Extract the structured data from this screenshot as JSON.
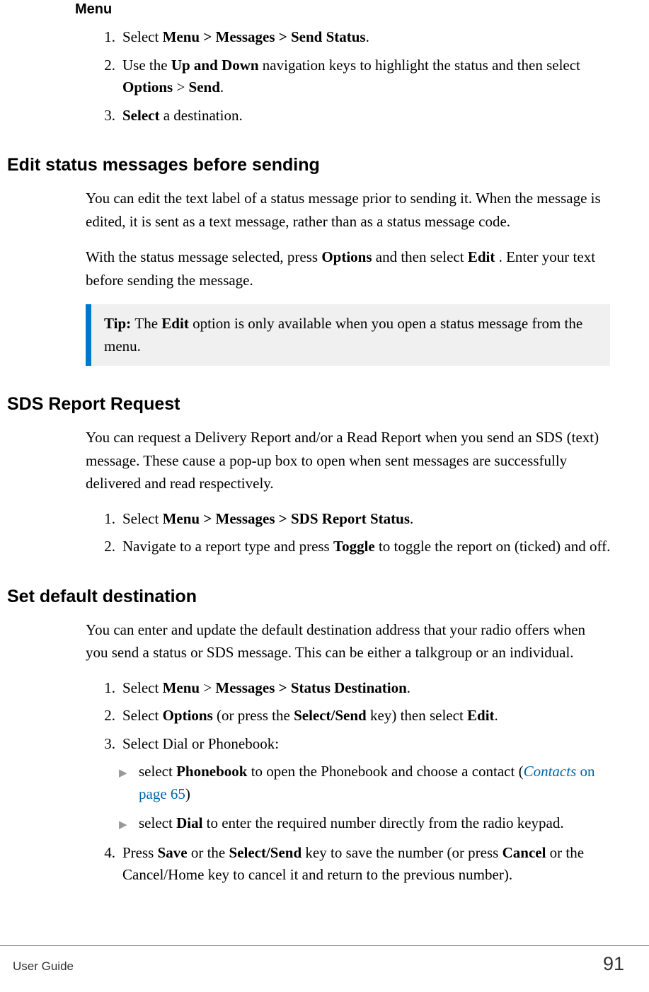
{
  "headings": {
    "menu": "Menu",
    "edit_status": "Edit status messages before sending",
    "sds_report": "SDS Report Request",
    "set_default": "Set default destination"
  },
  "menu_steps": {
    "s1_pre": "Select ",
    "s1_bold": "Menu > Messages > Send Status",
    "s1_post": ".",
    "s2_pre": "Use the ",
    "s2_b1": "Up and Down",
    "s2_mid": " navigation keys to highlight the status and then select ",
    "s2_b2": "Options",
    "s2_mid2": " > ",
    "s2_b3": "Send",
    "s2_post": ".",
    "s3_b": "Select",
    "s3_post": " a destination."
  },
  "edit_status": {
    "p1": "You can edit the text label of a status message prior to sending it. When the message is edited, it is sent as a text message, rather than as a status message code.",
    "p2_pre": "With the status message selected, press ",
    "p2_b1": "Options",
    "p2_mid": " and then select ",
    "p2_b2": "Edit",
    "p2_post": " . Enter your text before sending the message."
  },
  "tip": {
    "label": "Tip: ",
    "pre": " The ",
    "b": "Edit",
    "post": " option is only available when you open a status message from the menu."
  },
  "sds": {
    "p1": "You can request a Delivery Report and/or a Read Report when you send an SDS (text) message. These cause a pop-up box to open when sent messages are successfully delivered and read respectively.",
    "s1_pre": "Select ",
    "s1_bold": "Menu > Messages > SDS Report Status",
    "s1_post": ".",
    "s2_pre": "Navigate to a report type and press ",
    "s2_b": "Toggle",
    "s2_post": " to toggle the report on (ticked) and off."
  },
  "dest": {
    "p1": "You can enter and update the default destination address that your radio offers when you send a status or SDS message. This can be either a talkgroup or an individual.",
    "s1_pre": "Select ",
    "s1_b1": "Menu",
    "s1_mid": " > ",
    "s1_b2": "Messages > Status Destination",
    "s1_post": ".",
    "s2_pre": "Select ",
    "s2_b1": "Options",
    "s2_mid": " (or press the ",
    "s2_b2": "Select/Send",
    "s2_mid2": " key) then select ",
    "s2_b3": "Edit",
    "s2_post": ".",
    "s3": "Select Dial or Phonebook:",
    "sub1_pre": "select ",
    "sub1_b": "Phonebook",
    "sub1_mid": " to open the Phonebook and choose a contact (",
    "sub1_link_title": "Contacts",
    "sub1_link_rest": " on page 65",
    "sub1_post": ")",
    "sub2_pre": "select ",
    "sub2_b": "Dial",
    "sub2_post": " to enter the required number directly from the radio keypad.",
    "s4_pre": "Press ",
    "s4_b1": "Save",
    "s4_mid1": " or the ",
    "s4_b2": "Select/Send",
    "s4_mid2": " key to save the number (or press ",
    "s4_b3": "Cancel",
    "s4_post": " or the Cancel/Home key to cancel it and return to the previous number)."
  },
  "footer": {
    "left": "User Guide",
    "page": "91"
  }
}
